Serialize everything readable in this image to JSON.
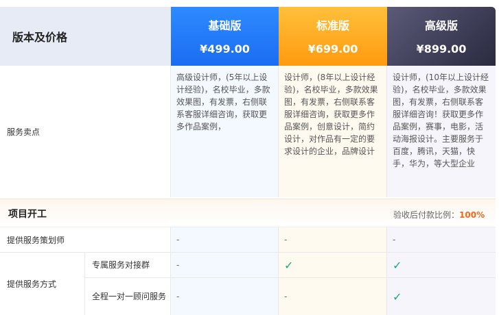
{
  "header": {
    "label": "版本及价格",
    "plans": [
      {
        "name": "基础版",
        "price": "¥499.00"
      },
      {
        "name": "标准版",
        "price": "¥699.00"
      },
      {
        "name": "高级版",
        "price": "¥899.00"
      }
    ]
  },
  "selling": {
    "label": "服务卖点",
    "basic": "高级设计师，(5年以上设计经验)，名校毕业，多款效果图，有发票，右侧联系客服详细咨询，获取更多作品案例，",
    "standard": "设计师，(8年以上设计经验)，名校毕业，多款效果图，有发票，右侧联系客服详细咨询，获取更多作品案例，创意设计，简约设计，对作品有一定的要求设计的企业，品牌设计",
    "advanced": "设计师，(10年以上设计经验)，名校毕业，多款效果图，有发票，右侧联系客服详细咨询！获取更多作品案例，赛事，电影，活动海报设计。主要服务于百度，腾讯，天猫，快手，华为，等大型企业"
  },
  "section": {
    "title": "项目开工",
    "ratio_label": "验收后付款比例：",
    "ratio_value": "100%"
  },
  "rows": {
    "planner": {
      "label": "提供服务策划师",
      "basic": "-",
      "standard": "-",
      "advanced": "-"
    },
    "method": {
      "label": "提供服务方式",
      "group": {
        "label": "专属服务对接群",
        "basic": "-",
        "standard": "✓",
        "advanced": "✓"
      },
      "consultant": {
        "label": "全程一对一顾问服务",
        "basic": "-",
        "standard": "-",
        "advanced": "✓"
      }
    }
  },
  "colors": {
    "basic": "#1a6cf2",
    "standard": "#ff9a10",
    "advanced": "#2a2a40",
    "check": "#1aaa6b",
    "ratio": "#f06a1a"
  },
  "icons": {
    "check": "check-icon"
  }
}
